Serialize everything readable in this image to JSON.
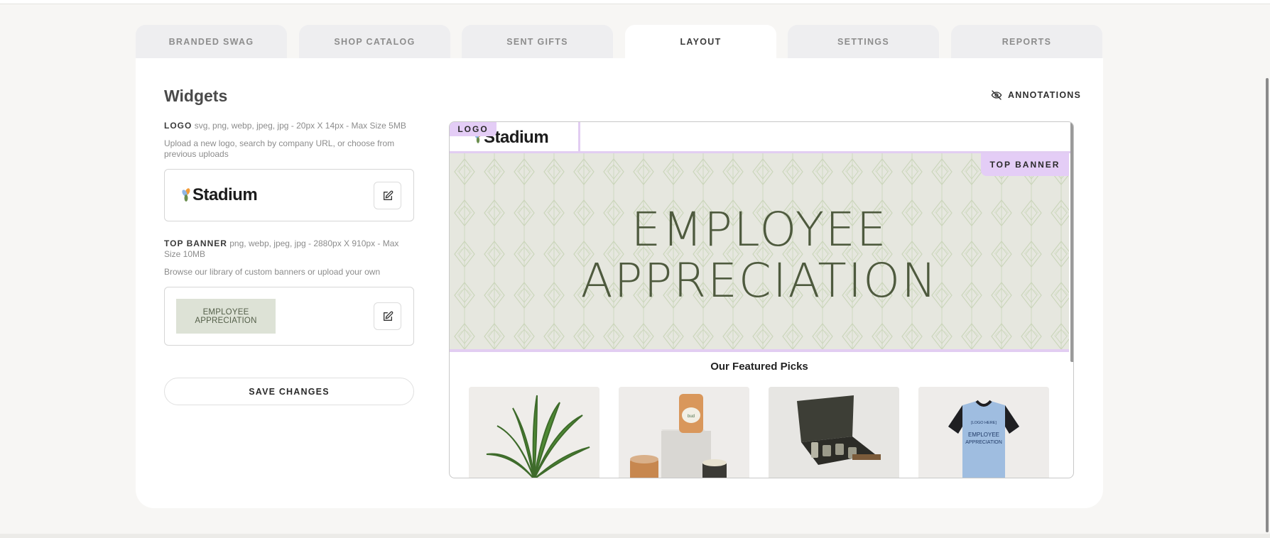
{
  "tabs": [
    {
      "label": "BRANDED SWAG",
      "active": false
    },
    {
      "label": "SHOP CATALOG",
      "active": false
    },
    {
      "label": "SENT GIFTS",
      "active": false
    },
    {
      "label": "LAYOUT",
      "active": true
    },
    {
      "label": "SETTINGS",
      "active": false
    },
    {
      "label": "REPORTS",
      "active": false
    }
  ],
  "widgets": {
    "title": "Widgets",
    "annotations_label": "ANNOTATIONS",
    "logo": {
      "label": "LOGO",
      "spec": "svg, png, webp, jpeg, jpg - 20px X 14px - Max Size 5MB",
      "hint": "Upload a new logo, search by company URL, or choose from previous uploads",
      "brand_name": "Stadium"
    },
    "top_banner": {
      "label": "TOP BANNER",
      "spec": "png, webp, jpeg, jpg - 2880px X 910px - Max Size 10MB",
      "hint": "Browse our library of custom banners or upload your own",
      "thumb_line1": "EMPLOYEE",
      "thumb_line2": "APPRECIATION"
    },
    "save_label": "SAVE CHANGES"
  },
  "preview": {
    "logo_tag": "LOGO",
    "banner_tag": "TOP BANNER",
    "brand_name": "Stadium",
    "banner_line1": "EMPLOYEE",
    "banner_line2": "APPRECIATION",
    "featured_title": "Our Featured Picks",
    "products": [
      {
        "icon": "plant-image"
      },
      {
        "icon": "candles-image"
      },
      {
        "icon": "whiskey-set-image"
      },
      {
        "icon": "jersey-image"
      }
    ],
    "jersey_text1": "[LOGO HERE]",
    "jersey_text2": "EMPLOYEE",
    "jersey_text3": "APPRECIATION"
  },
  "colors": {
    "accent_annotation": "#e4cdf6",
    "banner_text": "#4e5a3e",
    "tab_inactive_bg": "#eeeef0"
  }
}
